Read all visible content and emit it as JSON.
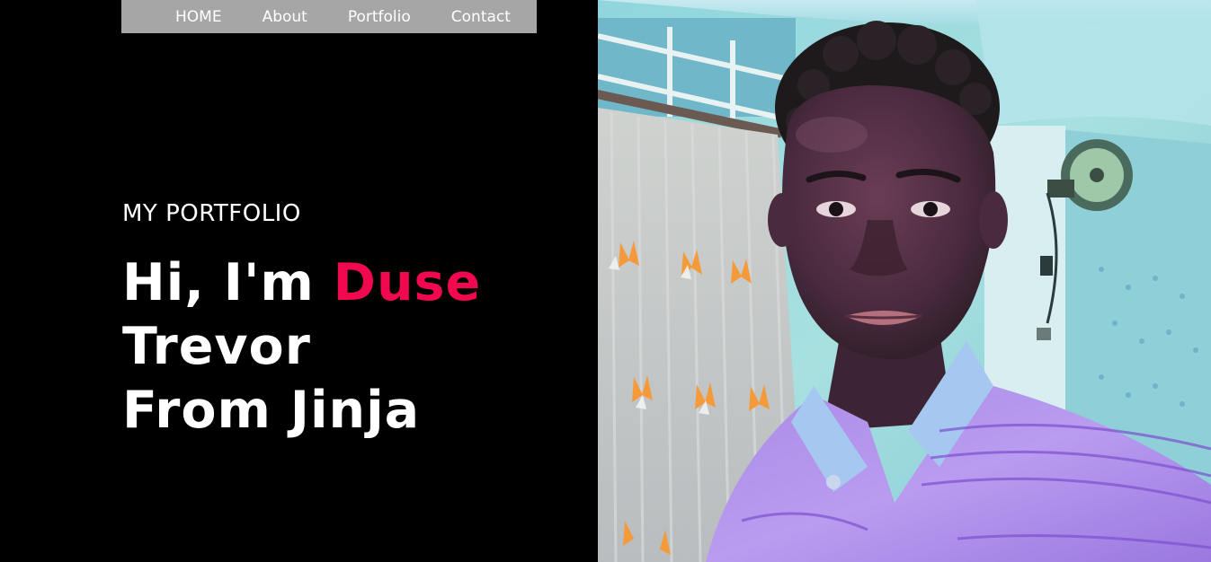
{
  "nav": {
    "items": [
      {
        "label": "HOME"
      },
      {
        "label": "About"
      },
      {
        "label": "Portfolio"
      },
      {
        "label": "Contact"
      }
    ]
  },
  "hero": {
    "subtitle": "MY PORTFOLIO",
    "greeting": "Hi, I'm ",
    "name_highlight": "Duse",
    "line2": "Trevor",
    "line3": "From Jinja"
  },
  "colors": {
    "background": "#000000",
    "nav_background": "#a6a6a6",
    "accent": "#f2084f",
    "text": "#ffffff"
  },
  "photo": {
    "description_icon": "portrait-photo"
  }
}
